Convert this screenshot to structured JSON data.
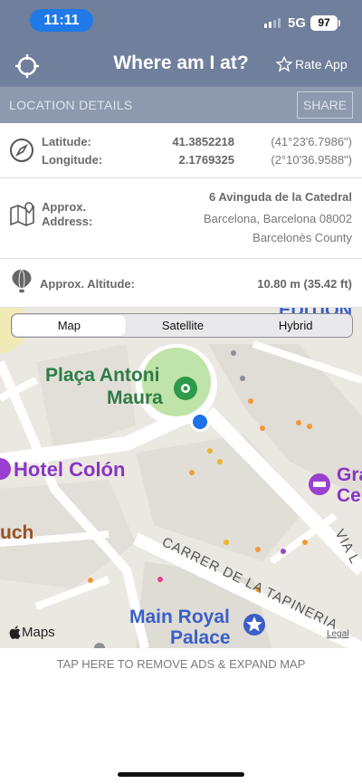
{
  "status_bar": {
    "time": "11:11",
    "network": "5G",
    "battery": "97"
  },
  "nav": {
    "title": "Where am I at?",
    "rate_label": "Rate App",
    "locate_icon": "crosshair-icon",
    "rate_icon": "star-outline-icon"
  },
  "section": {
    "label": "LOCATION DETAILS",
    "share_label": "SHARE"
  },
  "coordinates": {
    "icon": "compass-icon",
    "latitude_label": "Latitude:",
    "latitude_value": "41.3852218",
    "latitude_dms": "(41°23'6.7986\")",
    "longitude_label": "Longitude:",
    "longitude_value": "2.1769325",
    "longitude_dms": "(2°10'36.9588\")"
  },
  "address": {
    "icon": "map-pin-icon",
    "label_line1": "Approx.",
    "label_line2": "Address:",
    "line1": "6 Avinguda de la Catedral",
    "line2": "Barcelona, Barcelona 08002",
    "line3": "Barcelonès County"
  },
  "altitude": {
    "icon": "hot-air-balloon-icon",
    "label": "Approx. Altitude:",
    "value": "10.80 m (35.42 ft)"
  },
  "map": {
    "segments": [
      "Map",
      "Satellite",
      "Hybrid"
    ],
    "selected": "Map",
    "labels": {
      "plaza_line1": "Plaça Antoni",
      "plaza_line2": "Maura",
      "hotel": "Hotel Colón",
      "gran_line1": "Gra",
      "gran_line2": "Ce",
      "uch": "uch",
      "street": "CARRER DE LA TAPINERIA",
      "via": "VIA L",
      "edition": "EDITION",
      "palace_line1": "Main Royal",
      "palace_line2": "Palace"
    },
    "attribution": "Maps",
    "legal": "Legal"
  },
  "ads_text": "TAP HERE TO REMOVE ADS & EXPAND MAP",
  "colors": {
    "nav_bg": "#6f7f9c",
    "section_bg": "#8e99ad",
    "time_pill": "#1f7ae8",
    "park": "#bfe3a8",
    "poi_green": "#2e9a4b",
    "poi_purple": "#9b3fd1",
    "poi_blue": "#3a5fc8",
    "user_dot": "#1a73e8"
  }
}
